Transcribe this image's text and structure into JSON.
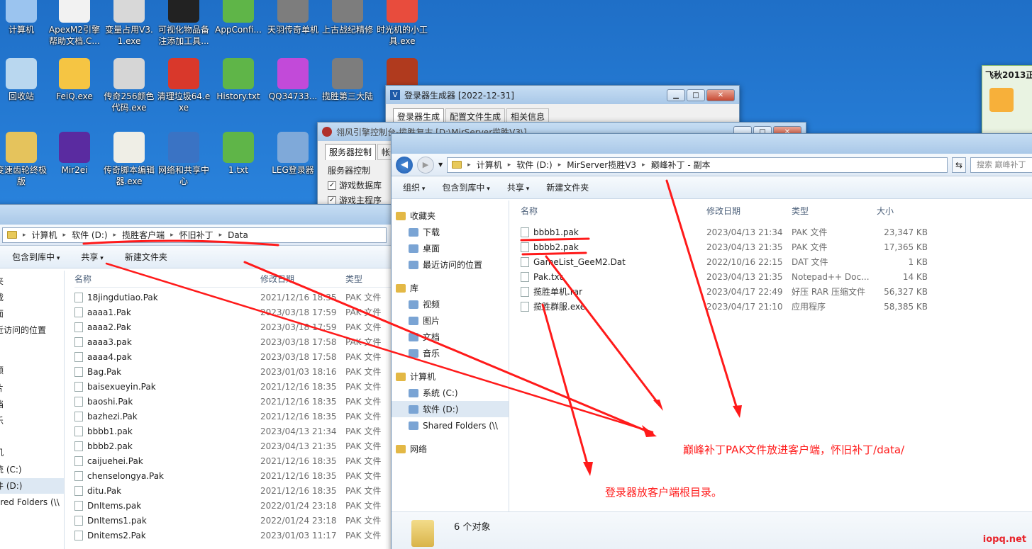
{
  "desktop_icons": [
    {
      "label": "计算机",
      "icon": "computer-icon",
      "color": "#9bc4ef"
    },
    {
      "label": "ApexM2引擎帮助文档.C...",
      "icon": "document-icon",
      "color": "#f2f2f2"
    },
    {
      "label": "变量占用V3.1.exe",
      "icon": "app-icon",
      "color": "#d8d8d8"
    },
    {
      "label": "可视化物品备注添加工具...",
      "icon": "app-icon",
      "color": "#222222"
    },
    {
      "label": "AppConfi...",
      "icon": "notepad-icon",
      "color": "#5fb548"
    },
    {
      "label": "天羽传奇单机",
      "icon": "game-icon",
      "color": "#7d7d7d"
    },
    {
      "label": "上古战纪精修",
      "icon": "game-icon",
      "color": "#7d7d7d"
    },
    {
      "label": "时光机的小工具.exe",
      "icon": "app-icon",
      "color": "#e84c3d"
    },
    {
      "label": "回收站",
      "icon": "recycle-bin-icon",
      "color": "#b9d7ef"
    },
    {
      "label": "FeiQ.exe",
      "icon": "chat-icon",
      "color": "#f5c543"
    },
    {
      "label": "传奇256颜色代码.exe",
      "icon": "apple-icon",
      "color": "#d6d6d6"
    },
    {
      "label": "清理垃圾64.exe",
      "icon": "cleaner-icon",
      "color": "#d9382b"
    },
    {
      "label": "History.txt",
      "icon": "notepad-icon",
      "color": "#5fb548"
    },
    {
      "label": "QQ34733...",
      "icon": "dbc-icon",
      "color": "#c24ad9"
    },
    {
      "label": "揽胜第三大陆",
      "icon": "game-icon",
      "color": "#7d7d7d"
    },
    {
      "label": "传奇",
      "icon": "game-icon",
      "color": "#b03a1e"
    },
    {
      "label": "变速齿轮终极版",
      "icon": "folder-icon",
      "color": "#e5c35c"
    },
    {
      "label": "Mir2ei",
      "icon": "game-icon",
      "color": "#5a2ba0"
    },
    {
      "label": "传奇脚本编辑器.exe",
      "icon": "editor-icon",
      "color": "#efeee6"
    },
    {
      "label": "网络和共享中心",
      "icon": "network-icon",
      "color": "#3a73c4"
    },
    {
      "label": "1.txt",
      "icon": "notepad-icon",
      "color": "#5fb548"
    },
    {
      "label": "LEG登录器",
      "icon": "app-icon",
      "color": "#7fa9d9"
    }
  ],
  "login_gen": {
    "title": "登录器生成器 [2022-12-31]",
    "tabs": [
      "登录器生成",
      "配置文件生成",
      "相关信息"
    ]
  },
  "engine_console": {
    "title": "翎风引擎控制台-揽胜复古 [D:\\MirServer揽胜V3\\]",
    "tabs": [
      "服务器控制",
      "帐号"
    ],
    "group_label": "服务器控制",
    "checkboxes": [
      "游戏数据库",
      "游戏主程序"
    ]
  },
  "side_widget": {
    "title": "飞秋2013正"
  },
  "left_explorer": {
    "path": [
      "计算机",
      "软件 (D:)",
      "揽胜客户端",
      "怀旧补丁",
      "Data"
    ],
    "toolbar": [
      "包含到库中",
      "共享",
      "新建文件夹"
    ],
    "nav": [
      "夹",
      "载",
      "面",
      "近访问的位置",
      "频",
      "片",
      "档",
      "乐",
      "机",
      "统 (C:)",
      "件 (D:)",
      "ared Folders (\\\\"
    ],
    "headers": {
      "name": "名称",
      "date": "修改日期",
      "type": "类型"
    },
    "files": [
      {
        "name": "18jingdutiao.Pak",
        "date": "2021/12/16 18:35",
        "type": "PAK 文件"
      },
      {
        "name": "aaaa1.Pak",
        "date": "2023/03/18 17:59",
        "type": "PAK 文件"
      },
      {
        "name": "aaaa2.Pak",
        "date": "2023/03/18 17:59",
        "type": "PAK 文件"
      },
      {
        "name": "aaaa3.pak",
        "date": "2023/03/18 17:58",
        "type": "PAK 文件"
      },
      {
        "name": "aaaa4.pak",
        "date": "2023/03/18 17:58",
        "type": "PAK 文件"
      },
      {
        "name": "Bag.Pak",
        "date": "2023/01/03 18:16",
        "type": "PAK 文件"
      },
      {
        "name": "baisexueyin.Pak",
        "date": "2021/12/16 18:35",
        "type": "PAK 文件"
      },
      {
        "name": "baoshi.Pak",
        "date": "2021/12/16 18:35",
        "type": "PAK 文件"
      },
      {
        "name": "bazhezi.Pak",
        "date": "2021/12/16 18:35",
        "type": "PAK 文件"
      },
      {
        "name": "bbbb1.pak",
        "date": "2023/04/13 21:34",
        "type": "PAK 文件"
      },
      {
        "name": "bbbb2.pak",
        "date": "2023/04/13 21:35",
        "type": "PAK 文件"
      },
      {
        "name": "caijuehei.Pak",
        "date": "2021/12/16 18:35",
        "type": "PAK 文件"
      },
      {
        "name": "chenselongya.Pak",
        "date": "2021/12/16 18:35",
        "type": "PAK 文件"
      },
      {
        "name": "ditu.Pak",
        "date": "2021/12/16 18:35",
        "type": "PAK 文件"
      },
      {
        "name": "DnItems.pak",
        "date": "2022/01/24 23:18",
        "type": "PAK 文件"
      },
      {
        "name": "DnItems1.pak",
        "date": "2022/01/24 23:18",
        "type": "PAK 文件"
      },
      {
        "name": "Dnitems2.Pak",
        "date": "2023/01/03 11:17",
        "type": "PAK 文件"
      }
    ]
  },
  "right_explorer": {
    "path": [
      "计算机",
      "软件 (D:)",
      "MirServer揽胜V3",
      "巅峰补丁 - 副本"
    ],
    "search_placeholder": "搜索 巅峰补丁",
    "toolbar": [
      "组织",
      "包含到库中",
      "共享",
      "新建文件夹"
    ],
    "nav": [
      {
        "label": "收藏夹",
        "group": true
      },
      {
        "label": "下载",
        "group": false
      },
      {
        "label": "桌面",
        "group": false
      },
      {
        "label": "最近访问的位置",
        "group": false
      },
      {
        "label": "库",
        "group": true
      },
      {
        "label": "视频",
        "group": false
      },
      {
        "label": "图片",
        "group": false
      },
      {
        "label": "文档",
        "group": false
      },
      {
        "label": "音乐",
        "group": false
      },
      {
        "label": "计算机",
        "group": true
      },
      {
        "label": "系统 (C:)",
        "group": false
      },
      {
        "label": "软件 (D:)",
        "group": false
      },
      {
        "label": "Shared Folders (\\\\",
        "group": false
      },
      {
        "label": "网络",
        "group": true
      }
    ],
    "headers": {
      "name": "名称",
      "date": "修改日期",
      "type": "类型",
      "size": "大小"
    },
    "files": [
      {
        "name": "bbbb1.pak",
        "date": "2023/04/13 21:34",
        "type": "PAK 文件",
        "size": "23,347 KB"
      },
      {
        "name": "bbbb2.pak",
        "date": "2023/04/13 21:35",
        "type": "PAK 文件",
        "size": "17,365 KB"
      },
      {
        "name": "GameList_GeeM2.Dat",
        "date": "2022/10/16 22:15",
        "type": "DAT 文件",
        "size": "1 KB"
      },
      {
        "name": "Pak.txt",
        "date": "2023/04/13 21:35",
        "type": "Notepad++ Doc...",
        "size": "14 KB"
      },
      {
        "name": "揽胜单机.rar",
        "date": "2023/04/17 22:49",
        "type": "好压 RAR 压缩文件",
        "size": "56,327 KB"
      },
      {
        "name": "揽胜群服.exe",
        "date": "2023/04/17 21:10",
        "type": "应用程序",
        "size": "58,385 KB"
      }
    ],
    "status": "6 个对象"
  },
  "annotations": {
    "pak_note": "巅峰补丁PAK文件放进客户端，怀旧补丁/data/",
    "launcher_note": "登录器放客户端根目录。",
    "watermark": "iopq.net",
    "color": "#ff1a1a"
  }
}
